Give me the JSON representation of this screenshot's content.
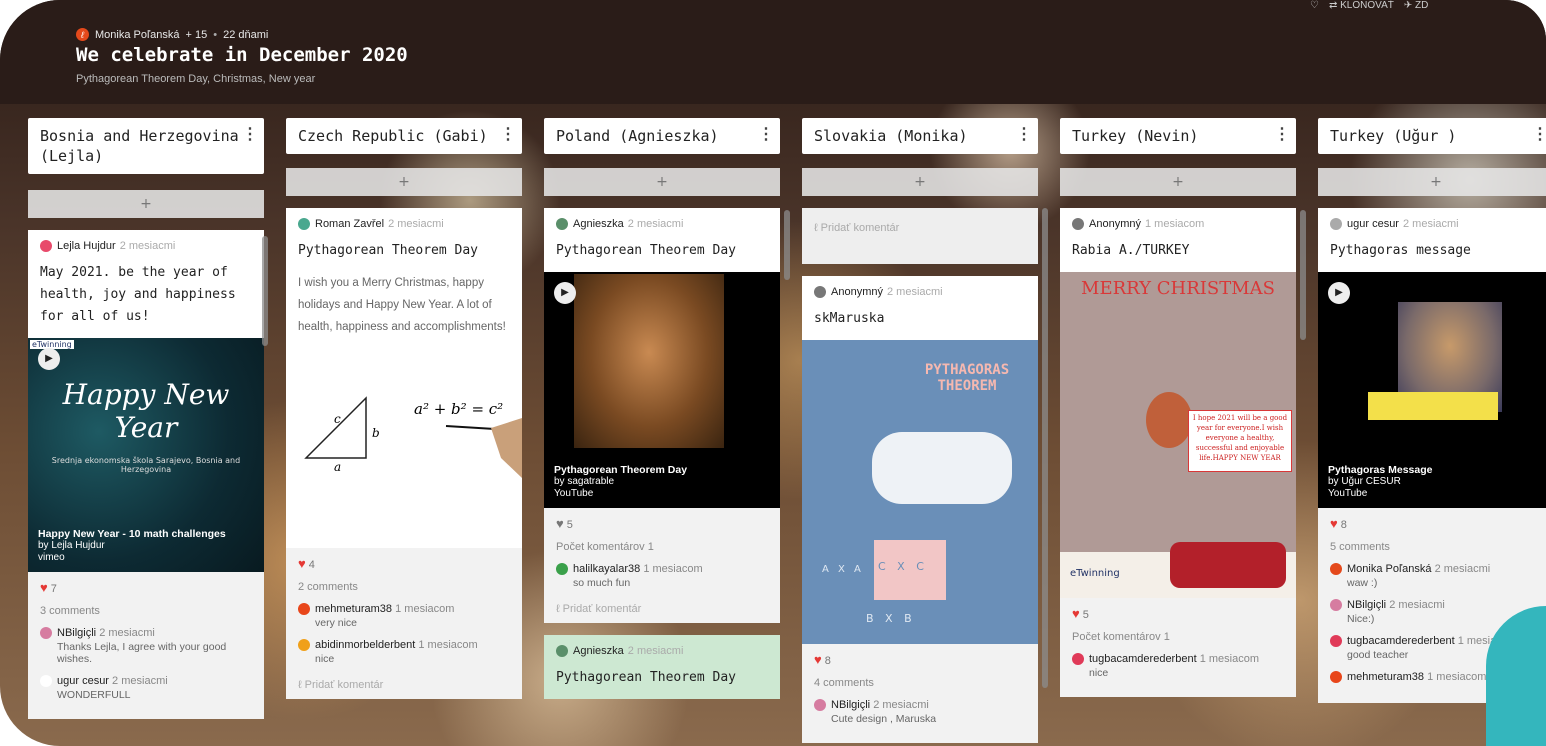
{
  "header": {
    "author": "Monika Poľanská",
    "plus": "+ 15",
    "age": "22 dňami",
    "title": "We celebrate in December 2020",
    "subtitle": "Pythagorean Theorem Day, Christmas, New year",
    "clone": "⇄ KLONOVAŤ",
    "share": "✈ ZD"
  },
  "colors": {
    "header_bg": "#2a1c18",
    "like": "#e53935",
    "accent": "#34b6bd"
  },
  "columns": [
    {
      "title": "Bosnia and Herzegovina (Lejla)",
      "add": "+",
      "card": {
        "author": "Lejla Hujdur",
        "time": "2 mesiacmi",
        "title": "May 2021. be the year of health, joy and happiness for all of us!",
        "media_title": "Happy New Year - 10 math challenges",
        "media_by": "by Lejla Hujdur",
        "media_src": "vimeo",
        "media_big": "Happy New Year",
        "media_small": "Srednja ekonomska škola Sarajevo, Bosnia and Herzegovina",
        "media_tag": "eTwinning",
        "likes": "7",
        "comments_label": "3 comments",
        "comments": [
          {
            "who": "NBilgiçli",
            "time": "2 mesiacmi",
            "text": "Thanks Lejla, I agree with your good wishes."
          },
          {
            "who": "ugur cesur",
            "time": "2 mesiacmi",
            "text": "WONDERFULL"
          }
        ]
      }
    },
    {
      "title": "Czech Republic (Gabi)",
      "add": "+",
      "card": {
        "author": "Roman Zavřel",
        "time": "2 mesiacmi",
        "title": "Pythagorean Theorem Day",
        "body": "I wish you a Merry Christmas, happy holidays and Happy New Year.  A lot of health, happiness and accomplishments!",
        "formula": "a² + b² = c²",
        "side_a": "a",
        "side_b": "b",
        "side_c": "c",
        "likes": "4",
        "comments_label": "2 comments",
        "comments": [
          {
            "who": "mehmeturam38",
            "time": "1 mesiacom",
            "text": "very nice"
          },
          {
            "who": "abidinmorbelderbent",
            "time": "1 mesiacom",
            "text": "nice"
          }
        ],
        "add_comment": "Pridať komentár"
      }
    },
    {
      "title": "Poland (Agnieszka)",
      "add": "+",
      "card": {
        "author": "Agnieszka",
        "time": "2 mesiacmi",
        "title": "Pythagorean Theorem Day",
        "media_title": "Pythagorean Theorem Day",
        "media_by": "by sagatrable",
        "media_src": "YouTube",
        "likes": "5",
        "comments_label": "Počet komentárov 1",
        "comments": [
          {
            "who": "halilkayalar38",
            "time": "1 mesiacom",
            "text": "so much fun"
          }
        ],
        "add_comment": "Pridať komentár"
      },
      "card2": {
        "author": "Agnieszka",
        "time": "2 mesiacmi",
        "title": "Pythagorean Theorem Day"
      }
    },
    {
      "title": "Slovakia (Monika)",
      "add": "+",
      "card0": {
        "add_comment": "Pridať komentár"
      },
      "card": {
        "author": "Anonymný",
        "time": "2 mesiacmi",
        "title": "skMaruska",
        "poster_title": "PYTHAGORAS THEOREM",
        "poster_cxc": "C X C",
        "poster_axa": "A X A",
        "poster_bxb": "B X B",
        "likes": "8",
        "comments_label": "4 comments",
        "comments": [
          {
            "who": "NBilgiçli",
            "time": "2 mesiacmi",
            "text": "Cute design , Maruska"
          }
        ]
      }
    },
    {
      "title": "Turkey (Nevin)",
      "add": "+",
      "card": {
        "author": "Anonymný",
        "time": "1 mesiacom",
        "title": "Rabia A./TURKEY",
        "poster_title": "MERRY CHRISTMAS",
        "poster_text": "I hope 2021 will be a good year for everyone.I wish everyone a healthy, successful and enjoyable life.HAPPY NEW YEAR",
        "poster_tag": "eTwinning",
        "likes": "5",
        "comments_label": "Počet komentárov 1",
        "comments": [
          {
            "who": "tugbacamderederbent",
            "time": "1 mesiacom",
            "text": "nice"
          }
        ]
      }
    },
    {
      "title": "Turkey (Uğur )",
      "add": "+",
      "card": {
        "author": "ugur cesur",
        "time": "2 mesiacmi",
        "title": "Pythagoras message",
        "media_title": "Pythagoras Message",
        "media_by": "by Uğur CESUR",
        "media_src": "YouTube",
        "likes": "8",
        "comments_label": "5 comments",
        "comments": [
          {
            "who": "Monika Poľanská",
            "time": "2 mesiacmi",
            "text": "waw :)"
          },
          {
            "who": "NBilgiçli",
            "time": "2 mesiacmi",
            "text": "Nice:)"
          },
          {
            "who": "tugbacamderederbent",
            "time": "1 mesiacom",
            "text": "good teacher"
          },
          {
            "who": "mehmeturam38",
            "time": "1 mesiacom",
            "text": ""
          }
        ]
      }
    }
  ]
}
